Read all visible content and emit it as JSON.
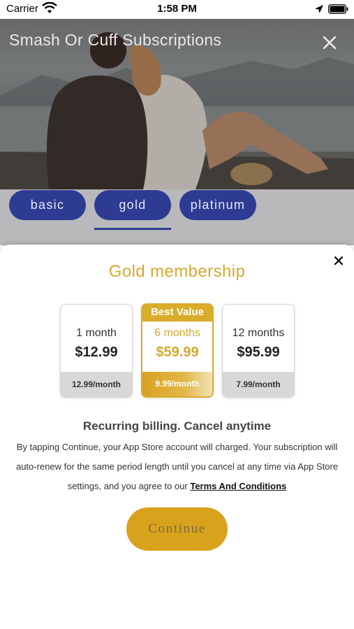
{
  "status_bar": {
    "carrier": "Carrier",
    "time": "1:58 PM"
  },
  "header": {
    "title": "Smash Or Cuff Subscriptions"
  },
  "tabs": [
    {
      "label": "basic",
      "selected": false
    },
    {
      "label": "gold",
      "selected": true
    },
    {
      "label": "platinum",
      "selected": false
    }
  ],
  "sheet": {
    "title": "Gold membership",
    "best_value_label": "Best Value",
    "plans": [
      {
        "period": "1 month",
        "price": "$12.99",
        "monthly": "12.99/month",
        "selected": false
      },
      {
        "period": "6 months",
        "price": "$59.99",
        "monthly": "9.99/month",
        "selected": true
      },
      {
        "period": "12 months",
        "price": "$95.99",
        "monthly": "7.99/month",
        "selected": false
      }
    ],
    "billing_heading": "Recurring billing. Cancel anytime",
    "billing_text": "By tapping Continue, your App Store account will charged. Your subscription will auto-renew for the same period length until you cancel at any time via App Store settings, and you agree to our",
    "terms_link": "Terms And Conditions",
    "continue_label": "Continue"
  },
  "colors": {
    "accent_gold": "#d6a82c",
    "tab_blue": "#2e3b93"
  },
  "icons": {
    "status_wifi": "wifi-icon",
    "status_location": "location-arrow-icon",
    "status_battery": "battery-icon",
    "header_close": "close-icon",
    "sheet_close": "close-icon"
  }
}
